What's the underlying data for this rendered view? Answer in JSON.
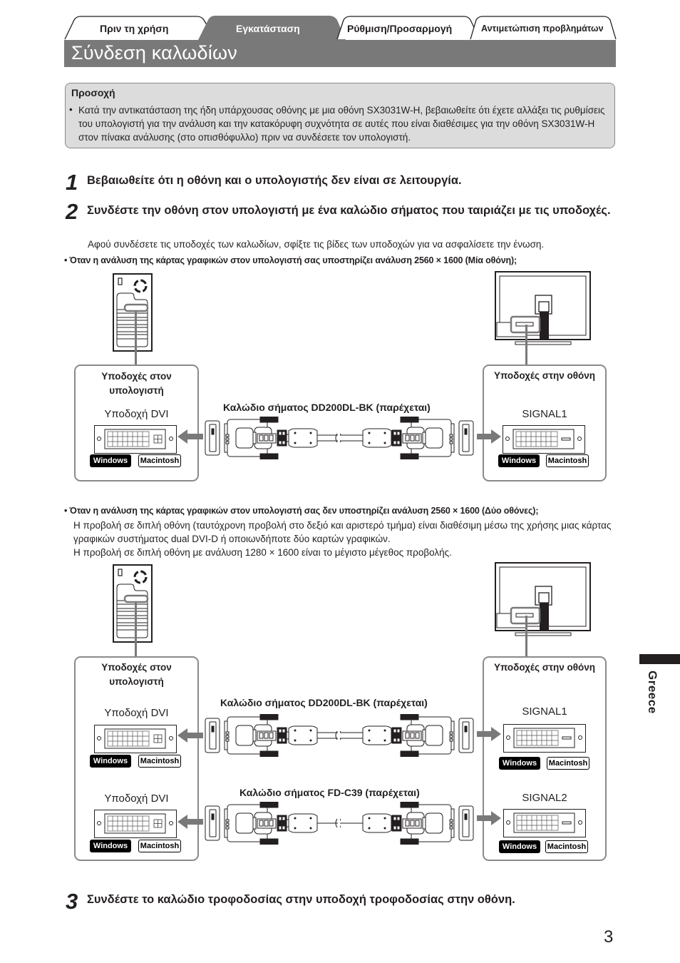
{
  "header": {
    "tabs": [
      {
        "label": "Πριν τη χρήση",
        "active": false
      },
      {
        "label": "Εγκατάσταση",
        "active": true
      },
      {
        "label": "Ρύθμιση/Προσαρμογή",
        "active": false
      },
      {
        "label": "Αντιμετώπιση προβλημάτων",
        "active": false
      }
    ],
    "title": "Σύνδεση καλωδίων"
  },
  "caution": {
    "title": "Προσοχή",
    "bullet": "•",
    "text": "Κατά την αντικατάσταση της ήδη υπάρχουσας οθόνης με μια οθόνη SX3031W-H, βεβαιωθείτε ότι έχετε αλλάξει τις ρυθμίσεις του υπολογιστή για την ανάλυση και την κατακόρυφη συχνότητα σε αυτές που είναι διαθέσιμες για την οθόνη SX3031W-H στον πίνακα ανάλυσης (στο οπισθόφυλλο) πριν να συνδέσετε τον υπολογιστή."
  },
  "steps": [
    {
      "number": "1",
      "text": "Βεβαιωθείτε ότι η οθόνη και ο υπολογιστής δεν είναι σε λειτουργία."
    },
    {
      "number": "2",
      "text": "Συνδέστε την οθόνη στον υπολογιστή με ένα καλώδιο σήματος που ταιριάζει με τις υποδοχές.",
      "note": "Αφού συνδέσετε τις υποδοχές των καλωδίων, σφίξτε τις βίδες των υποδοχών για να ασφαλίσετε την ένωση."
    },
    {
      "number": "3",
      "text": "Συνδέστε το καλώδιο τροφοδοσίας στην υποδοχή τροφοδοσίας στην οθόνη."
    }
  ],
  "case_single": {
    "heading": "• Όταν η ανάλυση της κάρτας γραφικών στον υπολογιστή σας υποστηρίζει ανάλυση 2560 × 1600 (Μία οθόνη);",
    "pc_panel_title": "Υποδοχές στον υπολογιστή",
    "monitor_panel_title": "Υποδοχές στην οθόνη",
    "pc_port": "Υποδοχή DVI",
    "monitor_port": "SIGNAL1",
    "cable": "Καλώδιο σήματος DD200DL-BK (παρέχεται)",
    "badges": {
      "windows": "Windows",
      "mac": "Macintosh"
    }
  },
  "case_dual": {
    "heading": "• Όταν η ανάλυση της κάρτας γραφικών στον υπολογιστή σας δεν υποστηρίζει ανάλυση 2560 × 1600 (Δύο οθόνες);",
    "text": [
      "Η προβολή σε διπλή οθόνη (ταυτόχρονη προβολή στο δεξιό και αριστερό τμήμα) είναι διαθέσιμη μέσω της χρήσης μιας κάρτας γραφικών συστήματος dual DVI-D ή οποιωνδήποτε δύο καρτών γραφικών.",
      "Η προβολή σε διπλή οθόνη με ανάλυση 1280 × 1600 είναι το μέγιστο μέγεθος προβολής."
    ],
    "pc_panel_title": "Υποδοχές στον υπολογιστή",
    "monitor_panel_title": "Υποδοχές στην οθόνη",
    "pc_ports": [
      "Υποδοχή DVI",
      "Υποδοχή DVI"
    ],
    "monitor_ports": [
      "SIGNAL1",
      "SIGNAL2"
    ],
    "cables": [
      "Καλώδιο σήματος DD200DL-BK (παρέχεται)",
      "Καλώδιο σήματος FD-C39 (παρέχεται)"
    ],
    "badges": {
      "windows": "Windows",
      "mac": "Macintosh"
    }
  },
  "side_tab": {
    "label": "Greece"
  },
  "page_number": "3"
}
